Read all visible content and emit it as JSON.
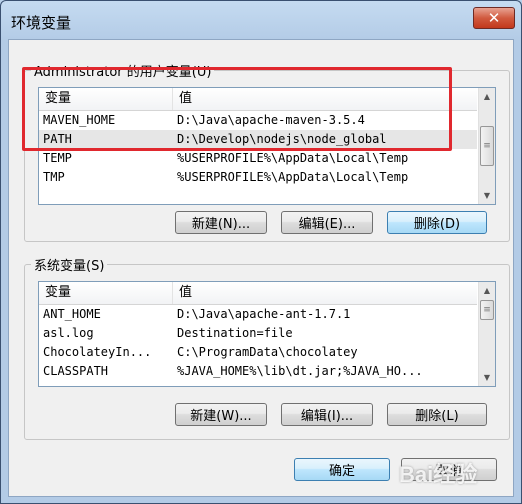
{
  "window": {
    "title": "环境变量",
    "close_label": "✕"
  },
  "user_vars": {
    "group_label": "Administrator 的用户变量(U)",
    "col_name": "变量",
    "col_value": "值",
    "rows": [
      {
        "name": "MAVEN_HOME",
        "value": "D:\\Java\\apache-maven-3.5.4"
      },
      {
        "name": "PATH",
        "value": "D:\\Develop\\nodejs\\node_global"
      },
      {
        "name": "TEMP",
        "value": "%USERPROFILE%\\AppData\\Local\\Temp"
      },
      {
        "name": "TMP",
        "value": "%USERPROFILE%\\AppData\\Local\\Temp"
      }
    ],
    "new_label": "新建(N)...",
    "edit_label": "编辑(E)...",
    "delete_label": "删除(D)"
  },
  "system_vars": {
    "group_label": "系统变量(S)",
    "col_name": "变量",
    "col_value": "值",
    "rows": [
      {
        "name": "ANT_HOME",
        "value": "D:\\Java\\apache-ant-1.7.1"
      },
      {
        "name": "asl.log",
        "value": "Destination=file"
      },
      {
        "name": "ChocolateyIn...",
        "value": "C:\\ProgramData\\chocolatey"
      },
      {
        "name": "CLASSPATH",
        "value": "%JAVA_HOME%\\lib\\dt.jar;%JAVA_HO..."
      }
    ],
    "new_label": "新建(W)...",
    "edit_label": "编辑(I)...",
    "delete_label": "删除(L)"
  },
  "footer": {
    "ok_label": "确定",
    "cancel_label": "取消"
  },
  "watermark": "Bai经验",
  "colors": {
    "highlight": "#e0282e",
    "titlebar": "#c5dbf1",
    "close": "#c2381c"
  }
}
